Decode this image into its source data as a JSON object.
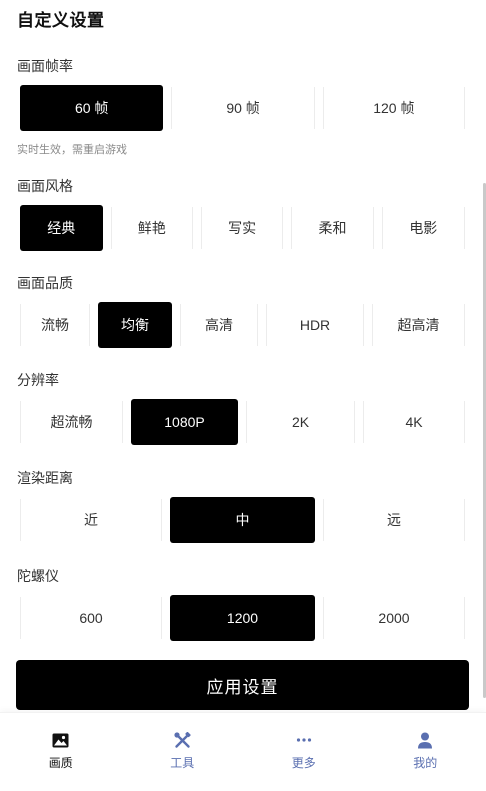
{
  "header": {
    "title": "自定义设置"
  },
  "sections": {
    "framerate": {
      "label": "画面帧率",
      "hint": "实时生效，需重启游戏",
      "options": [
        "60 帧",
        "90 帧",
        "120 帧"
      ],
      "selected": "60 帧"
    },
    "style": {
      "label": "画面风格",
      "options": [
        "经典",
        "鲜艳",
        "写实",
        "柔和",
        "电影"
      ],
      "selected": "经典"
    },
    "quality": {
      "label": "画面品质",
      "options": [
        "流畅",
        "均衡",
        "高清",
        "HDR",
        "超高清"
      ],
      "selected": "均衡"
    },
    "resolution": {
      "label": "分辨率",
      "options": [
        "超流畅",
        "1080P",
        "2K",
        "4K"
      ],
      "selected": "1080P"
    },
    "render_distance": {
      "label": "渲染距离",
      "options": [
        "近",
        "中",
        "远"
      ],
      "selected": "中"
    },
    "gyroscope": {
      "label": "陀螺仪",
      "options": [
        "600",
        "1200",
        "2000"
      ],
      "selected": "1200"
    }
  },
  "apply_button": {
    "label": "应用设置"
  },
  "tabbar": {
    "items": [
      {
        "label": "画质",
        "icon": "image-icon",
        "active": true
      },
      {
        "label": "工具",
        "icon": "tools-icon",
        "active": false
      },
      {
        "label": "更多",
        "icon": "more-icon",
        "active": false
      },
      {
        "label": "我的",
        "icon": "user-icon",
        "active": false
      }
    ]
  },
  "colors": {
    "accent": "#000000",
    "tab_inactive": "#5a6fb0",
    "text": "#333333"
  }
}
